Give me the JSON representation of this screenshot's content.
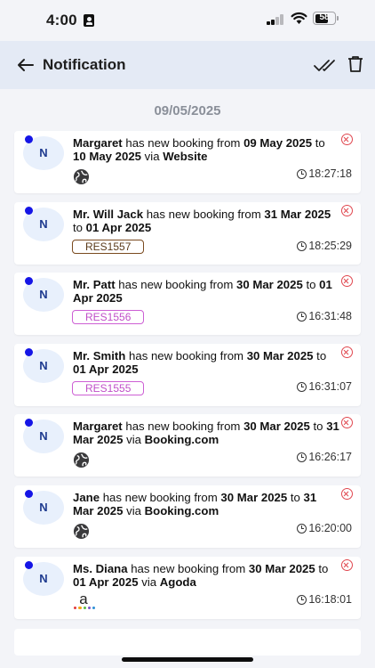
{
  "status_bar": {
    "time": "4:00",
    "battery": "58",
    "signal_bars_filled": 2,
    "signal_bars_total": 4
  },
  "header": {
    "title": "Notification"
  },
  "date_header": "09/05/2025",
  "colors": {
    "unread_dot": "#1515e6",
    "delete": "#e0474f",
    "header_bg": "#e4eaf5",
    "badge_brown": "#7a4a1f",
    "badge_pink": "#cd5fd4"
  },
  "notifications": [
    {
      "avatar": "N",
      "name": "Margaret",
      "text": " has new booking from ",
      "from": "09 May 2025",
      "to_word": " to ",
      "to": "10 May 2025",
      "via_word": " via ",
      "source": "Website",
      "time": "18:27:18",
      "icon": "globe-icon"
    },
    {
      "avatar": "N",
      "name": "Mr. Will Jack",
      "text": " has new booking from ",
      "from": "31 Mar 2025",
      "to_word": " to ",
      "to": "01 Apr 2025",
      "time": "18:25:29",
      "badge": "RES1557"
    },
    {
      "avatar": "N",
      "name": "Mr. Patt",
      "text": " has new booking from ",
      "from": "30 Mar 2025",
      "to_word": " to ",
      "to": "01 Apr 2025",
      "time": "16:31:48",
      "badge": "RES1556"
    },
    {
      "avatar": "N",
      "name": "Mr. Smith",
      "text": " has new booking from ",
      "from": "30 Mar 2025",
      "to_word": " to ",
      "to": "01 Apr 2025",
      "time": "16:31:07",
      "badge": "RES1555"
    },
    {
      "avatar": "N",
      "name": "Margaret",
      "text": " has new booking from ",
      "from": "30 Mar 2025",
      "to_word": " to ",
      "to": "31 Mar 2025",
      "via_word": " via ",
      "source": "Booking.com",
      "time": "16:26:17",
      "icon": "globe-icon"
    },
    {
      "avatar": "N",
      "name": "Jane",
      "text": " has new booking from ",
      "from": "30 Mar 2025",
      "to_word": " to ",
      "to": "31 Mar 2025",
      "via_word": " via ",
      "source": "Booking.com",
      "time": "16:20:00",
      "icon": "globe-icon"
    },
    {
      "avatar": "N",
      "name": "Ms. Diana",
      "text": " has new booking from ",
      "from": "30 Mar 2025",
      "to_word": " to ",
      "to": "01 Apr 2025",
      "via_word": " via ",
      "source": "Agoda",
      "time": "16:18:01",
      "icon": "agoda-logo-icon",
      "icon_letter": "a"
    }
  ]
}
